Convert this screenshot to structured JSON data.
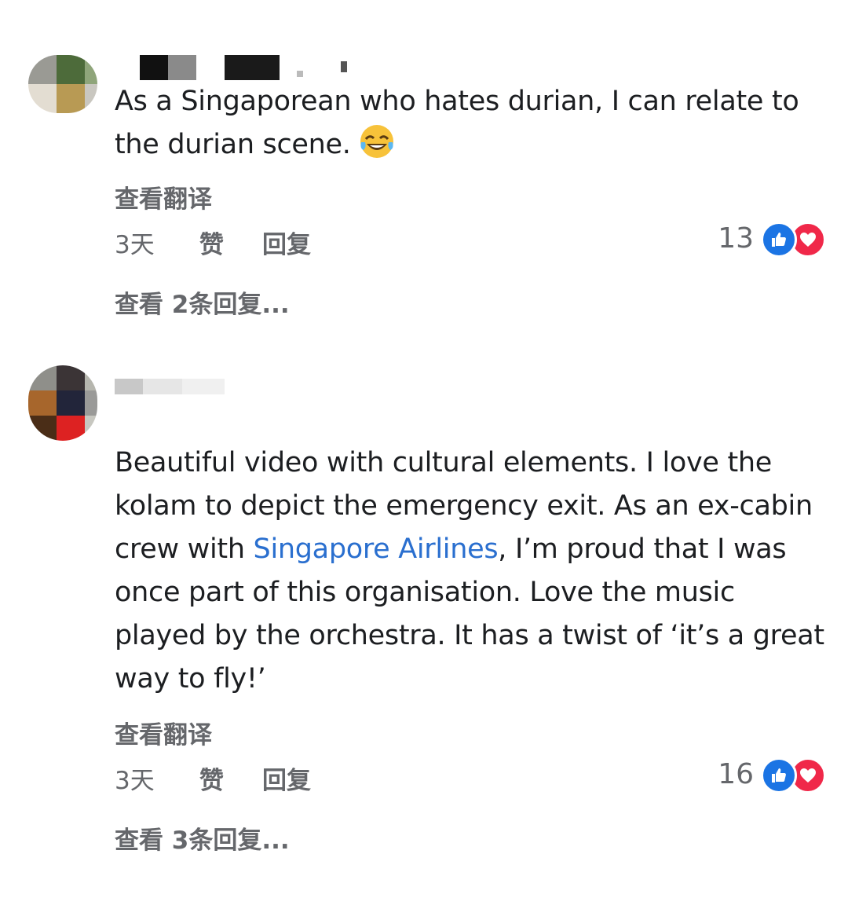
{
  "comments": [
    {
      "text": "As a Singaporean who hates durian, I can relate to the durian scene.",
      "emoji": "laughing-tears-emoji",
      "translate_label": "查看翻译",
      "time": "3天",
      "like_label": "赞",
      "reply_label": "回复",
      "reaction_count": "13",
      "reaction_icons": [
        "like-icon",
        "love-icon"
      ],
      "view_replies": "查看 2条回复..."
    },
    {
      "text_before_link": "Beautiful video with cultural elements. I love the kolam to depict the emergency exit. As an ex-cabin crew with ",
      "link_text": "Singapore Airlines",
      "text_after_link": ", I’m proud that I was once part of this organisation. Love the music played by the orchestra. It has a twist of ‘it’s a great way to fly!’",
      "translate_label": "查看翻译",
      "time": "3天",
      "like_label": "赞",
      "reply_label": "回复",
      "reaction_count": "16",
      "reaction_icons": [
        "like-icon",
        "love-icon"
      ],
      "view_replies": "查看 3条回复..."
    }
  ],
  "colors": {
    "text": "#1c1e21",
    "secondary": "#65676b",
    "link": "#2a6fcf",
    "like": "#1b74e4",
    "love": "#f02849"
  }
}
